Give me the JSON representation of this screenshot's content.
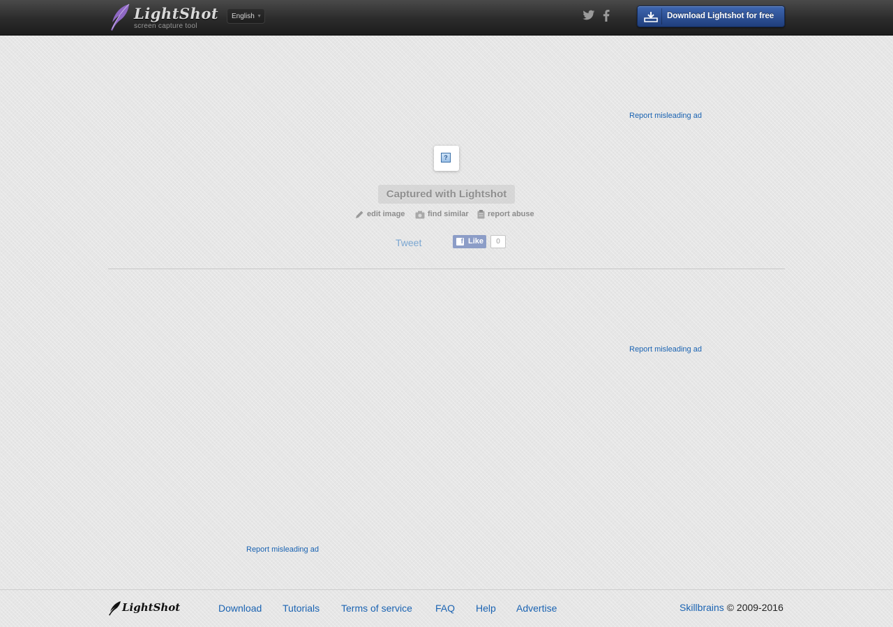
{
  "header": {
    "logo_title": "LightShot",
    "logo_subtitle": "screen capture tool",
    "language": "English",
    "download_button": "Download Lightshot for free"
  },
  "ads": {
    "report_label": "Report misleading ad"
  },
  "image": {
    "caption": "Captured with Lightshot"
  },
  "actions": {
    "edit_image": "edit image",
    "find_similar": "find similar",
    "report_abuse": "report abuse"
  },
  "share": {
    "tweet": "Tweet",
    "like": "Like",
    "like_count": "0"
  },
  "footer": {
    "logo": "LightShot",
    "links": [
      "Download",
      "Tutorials",
      "Terms of service",
      "FAQ",
      "Help",
      "Advertise"
    ],
    "company": "Skillbrains",
    "copyright": "© 2009-2016"
  },
  "colors": {
    "link": "#1a63b2",
    "download_button": "#2d4f93",
    "like_button": "#8c9dc7",
    "logo_feather": "#8f68c4"
  }
}
